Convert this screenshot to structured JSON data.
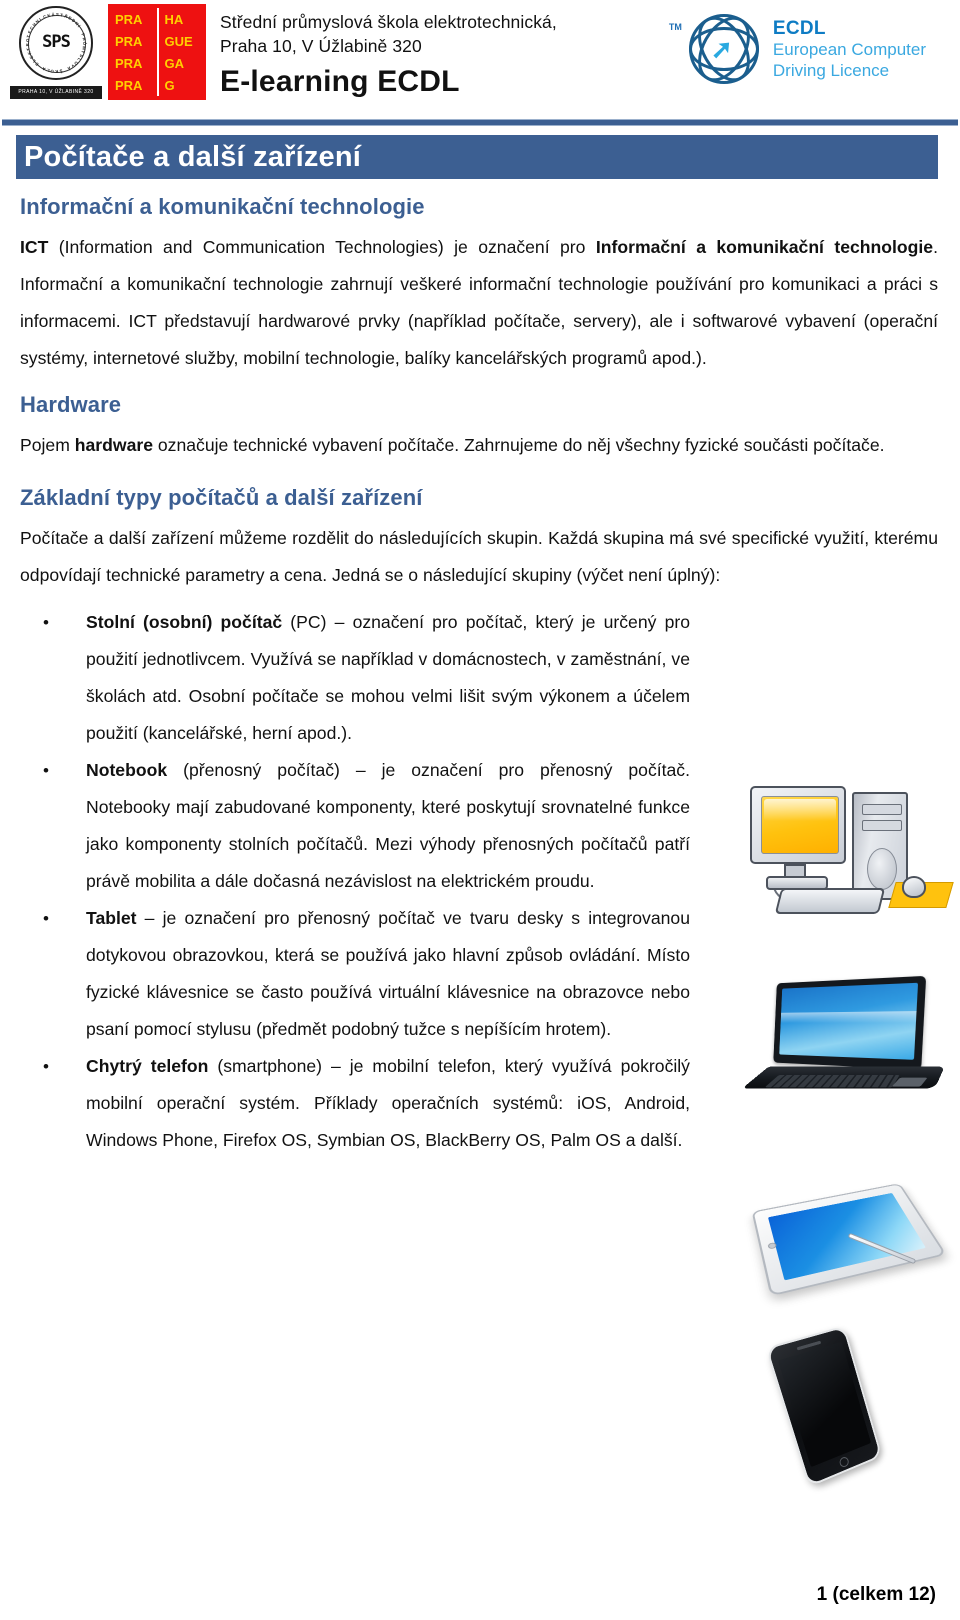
{
  "header": {
    "seal": {
      "monogram": "SPS",
      "ring_text": "STŘEDNÍ PRŮMYSLOVÁ ŠKOLA ELEKTROTECHNICKÁ",
      "band_text": "PRAHA 10, V ÚŽLABINĚ 320"
    },
    "praha_block": {
      "left": [
        "PRA",
        "PRA",
        "PRA",
        "PRA"
      ],
      "right": [
        "HA",
        "GUE",
        "GA",
        "G"
      ]
    },
    "school_line_1": "Střední průmyslová škola elektrotechnická,",
    "school_line_2": "Praha 10, V Úžlabině 320",
    "program": "E-learning ECDL",
    "ecdl": {
      "tm": "TM",
      "title": "ECDL",
      "line1": "European Computer",
      "line2": "Driving Licence"
    }
  },
  "document": {
    "page_title": "Počítače a další zařízení",
    "sections": [
      {
        "heading": "Informační a komunikační technologie",
        "paragraph_parts": [
          {
            "text": "ICT",
            "bold": true
          },
          {
            "text": " (Information and Communication Technologies) je označení pro ",
            "bold": false
          },
          {
            "text": "Informační a komunikační technologie",
            "bold": true
          },
          {
            "text": ". Informační a komunikační technologie zahrnují veškeré informační technologie používání pro komunikaci a práci s informacemi. ICT představují hardwarové prvky (například počítače, servery), ale i softwarové vybavení (operační systémy, internetové služby, mobilní technologie, balíky kancelářských programů apod.).",
            "bold": false
          }
        ]
      },
      {
        "heading": "Hardware",
        "paragraph_parts": [
          {
            "text": "Pojem ",
            "bold": false
          },
          {
            "text": "hardware",
            "bold": true
          },
          {
            "text": " označuje technické vybavení počítače. Zahrnujeme do něj všechny fyzické součásti počítače.",
            "bold": false
          }
        ]
      },
      {
        "heading": "Základní typy počítačů a další zařízení",
        "paragraph_parts": [
          {
            "text": "Počítače a další zařízení můžeme rozdělit do následujících skupin. Každá skupina má své specifické využití, kterému odpovídají technické parametry a cena. Jedná se o následující skupiny (výčet není úplný):",
            "bold": false
          }
        ]
      }
    ],
    "groups": [
      {
        "term": "Stolní (osobní) počítač",
        "rest": " (PC) – označení pro počítač, který je určený pro použití jednotlivcem. Využívá se například v domácnostech, v zaměstnání, ve školách atd. Osobní počítače se mohou velmi lišit svým výkonem a účelem použití (kancelářské, herní apod.).",
        "image": "desktop-computer-illustration"
      },
      {
        "term": "Notebook",
        "rest": " (přenosný počítač) – je označení pro přenosný počítač. Notebooky mají zabudované komponenty, které poskytují srovnatelné funkce jako komponenty stolních počítačů. Mezi výhody přenosných počítačů patří právě mobilita a dále dočasná nezávislost na elektrickém proudu.",
        "image": "laptop-illustration"
      },
      {
        "term": "Tablet",
        "rest": " – je označení pro přenosný počítač ve tvaru desky s integrovanou dotykovou obrazovkou, která se používá jako hlavní způsob ovládání. Místo fyzické klávesnice se často používá virtuální klávesnice na obrazovce nebo psaní pomocí stylusu (předmět podobný tužce s nepíšícím hrotem).",
        "image": "tablet-illustration"
      },
      {
        "term": "Chytrý telefon",
        "rest": " (smartphone) – je mobilní telefon, který využívá pokročilý mobilní operační systém. Příklady operačních systémů: iOS, Android, Windows Phone, Firefox OS, Symbian OS, BlackBerry OS, Palm OS a další.",
        "image": "smartphone-illustration"
      }
    ],
    "footer": "1 (celkem 12)"
  },
  "colors": {
    "accent_blue": "#3c5f92",
    "praha_red": "#ee1111",
    "praha_yellow": "#ffd000",
    "ecdl_blue": "#0e7cc4"
  }
}
